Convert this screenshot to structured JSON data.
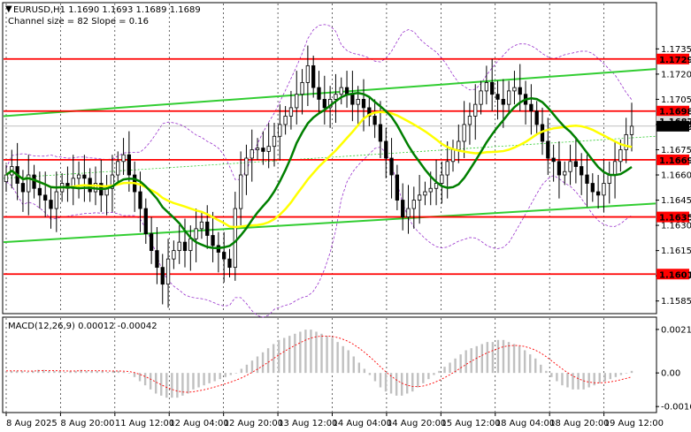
{
  "header": {
    "symbol_line": "EURUSD,H1  1.1690 1.1693 1.1689 1.1689",
    "channel_line": "Channel size = 82 Slope = 0.16",
    "collapse_glyph": "▼"
  },
  "macd": {
    "label": "MACD(12,26,9) 0.00012 -0.00042",
    "y_ticks": [
      "0.00211",
      "0.00",
      "-0.00163"
    ],
    "values": [
      0.0001,
      0.0001,
      0.0001,
      0.0001,
      5e-05,
      0.0001,
      0.00015,
      0.00015,
      0.0001,
      0.0001,
      0.0001,
      5e-05,
      0.0001,
      0.0001,
      0.00015,
      0.0001,
      0.0001,
      0.0001,
      0.0001,
      5e-05,
      0.0001,
      0.0001,
      5e-05,
      0,
      -0.0002,
      -0.0004,
      -0.0006,
      -0.0008,
      -0.001,
      -0.0011,
      -0.0012,
      -0.0012,
      -0.0012,
      -0.0011,
      -0.001,
      -0.0008,
      -0.0007,
      -0.0006,
      -0.0005,
      -0.0004,
      -0.0003,
      -0.0002,
      -0.0001,
      0,
      0.0002,
      0.0004,
      0.0006,
      0.0008,
      0.001,
      0.0012,
      0.0014,
      0.0016,
      0.0017,
      0.0018,
      0.0019,
      0.002,
      0.0021,
      0.0021,
      0.002,
      0.0019,
      0.0018,
      0.0017,
      0.0015,
      0.0013,
      0.0011,
      0.0008,
      0.0005,
      0.0002,
      -0.0001,
      -0.0004,
      -0.0007,
      -0.0009,
      -0.001,
      -0.0011,
      -0.0011,
      -0.001,
      -0.0009,
      -0.0007,
      -0.0005,
      -0.0003,
      -0.0001,
      0.0001,
      0.0003,
      0.0005,
      0.0007,
      0.0009,
      0.0011,
      0.0012,
      0.0013,
      0.0014,
      0.0015,
      0.0015,
      0.0016,
      0.0016,
      0.0015,
      0.0014,
      0.0013,
      0.0011,
      0.0009,
      0.0007,
      0.0004,
      0.0001,
      -0.0002,
      -0.0004,
      -0.0006,
      -0.0007,
      -0.0008,
      -0.0008,
      -0.0008,
      -0.0007,
      -0.0006,
      -0.0005,
      -0.0004,
      -0.0003,
      -0.0002,
      -0.0001,
      0,
      0.0001
    ]
  },
  "colors": {
    "background": "#ffffff",
    "candle": "#000000",
    "level_line": "#ff0000",
    "channel": "#32cd32",
    "sma_green": "#007f00",
    "sma_yellow": "#ffff00",
    "bollinger": "#9932cc",
    "macd_hist": "#c0c0c0",
    "macd_signal": "#ff0000",
    "current_price_tag": "#000000"
  },
  "chart_data": {
    "type": "candlestick",
    "ylim": [
      1.1578,
      1.1762
    ],
    "y_ticks": [
      "1.1735",
      "1.1720",
      "1.1705",
      "1.1690",
      "1.1675",
      "1.1660",
      "1.1645",
      "1.1630",
      "1.1615",
      "1.1600",
      "1.1585"
    ],
    "x_ticks": [
      "8 Aug 2025",
      "8 Aug 20:00",
      "11 Aug 12:00",
      "12 Aug 04:00",
      "12 Aug 20:00",
      "13 Aug 12:00",
      "14 Aug 04:00",
      "14 Aug 20:00",
      "15 Aug 12:00",
      "18 Aug 04:00",
      "18 Aug 20:00",
      "19 Aug 12:00"
    ],
    "levels": [
      {
        "value": 1.1729,
        "label": "1.1729"
      },
      {
        "value": 1.1698,
        "label": "1.1698"
      },
      {
        "value": 1.1669,
        "label": "1.1669"
      },
      {
        "value": 1.1635,
        "label": "1.1635"
      },
      {
        "value": 1.1601,
        "label": "1.1601"
      }
    ],
    "price_tags": [
      {
        "value": 1.1689,
        "label": "1.1689",
        "style": "current"
      },
      {
        "value": 1.1692,
        "label": "1.1687",
        "style": "ask"
      }
    ],
    "channel": {
      "upper": [
        1.1695,
        1.1723
      ],
      "lower": [
        1.162,
        1.1643
      ],
      "middle": [
        1.1658,
        1.1683
      ]
    },
    "close": [
      1.166,
      1.1665,
      1.1655,
      1.165,
      1.166,
      1.1652,
      1.1648,
      1.1645,
      1.164,
      1.165,
      1.1655,
      1.1652,
      1.1658,
      1.166,
      1.1658,
      1.165,
      1.1655,
      1.1648,
      1.1652,
      1.166,
      1.1668,
      1.1672,
      1.166,
      1.165,
      1.164,
      1.1625,
      1.1615,
      1.1605,
      1.1595,
      1.161,
      1.1615,
      1.162,
      1.1615,
      1.1622,
      1.1628,
      1.1632,
      1.1624,
      1.1618,
      1.1614,
      1.161,
      1.1605,
      1.164,
      1.166,
      1.167,
      1.1675,
      1.1676,
      1.1674,
      1.1677,
      1.1683,
      1.169,
      1.1695,
      1.17,
      1.1708,
      1.1715,
      1.1725,
      1.1712,
      1.1705,
      1.17,
      1.1705,
      1.1708,
      1.1712,
      1.1708,
      1.1702,
      1.1705,
      1.17,
      1.1695,
      1.169,
      1.168,
      1.167,
      1.166,
      1.1645,
      1.1635,
      1.164,
      1.1645,
      1.1648,
      1.165,
      1.1652,
      1.1655,
      1.166,
      1.1668,
      1.1675,
      1.168,
      1.169,
      1.1695,
      1.1702,
      1.171,
      1.1715,
      1.1708,
      1.1705,
      1.1702,
      1.171,
      1.1712,
      1.1708,
      1.1702,
      1.1698,
      1.169,
      1.168,
      1.167,
      1.1668,
      1.166,
      1.1662,
      1.1668,
      1.1665,
      1.166,
      1.1655,
      1.165,
      1.1648,
      1.1655,
      1.166,
      1.1668,
      1.1675,
      1.1684,
      1.1689
    ]
  }
}
